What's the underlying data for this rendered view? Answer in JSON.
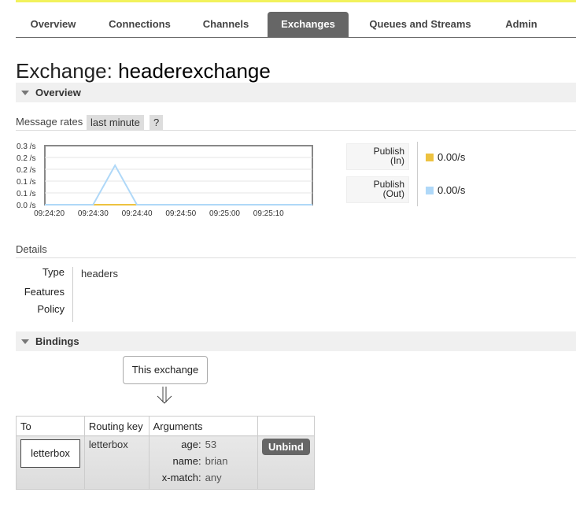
{
  "nav": {
    "items": [
      {
        "label": "Overview"
      },
      {
        "label": "Connections"
      },
      {
        "label": "Channels"
      },
      {
        "label": "Exchanges"
      },
      {
        "label": "Queues and Streams"
      },
      {
        "label": "Admin"
      }
    ],
    "active": "Exchanges"
  },
  "page": {
    "title_prefix": "Exchange:",
    "exchange_name": "headerexchange"
  },
  "overview": {
    "section_label": "Overview",
    "message_rates_label": "Message rates",
    "range_button": "last minute",
    "help_button": "?",
    "rates": [
      {
        "label_line1": "Publish",
        "label_line2": "(In)",
        "value": "0.00/s",
        "color": "#edc240"
      },
      {
        "label_line1": "Publish",
        "label_line2": "(Out)",
        "value": "0.00/s",
        "color": "#afd8f8"
      }
    ]
  },
  "chart_data": {
    "type": "line",
    "y_tick_labels": [
      "0.3 /s",
      "0.2 /s",
      "0.2 /s",
      "0.1 /s",
      "0.1 /s",
      "0.0 /s"
    ],
    "x_tick_labels": [
      "09:24:20",
      "09:24:30",
      "09:24:40",
      "09:24:50",
      "09:25:00",
      "09:25:10"
    ],
    "ylim": [
      0,
      0.3
    ],
    "grid": true,
    "series": [
      {
        "color": "#edc240",
        "points": [
          {
            "x": "09:24:19",
            "y": 0
          },
          {
            "x": "09:25:20",
            "y": 0
          }
        ]
      },
      {
        "color": "#afd8f8",
        "points": [
          {
            "x": "09:24:19",
            "y": 0
          },
          {
            "x": "09:24:30",
            "y": 0
          },
          {
            "x": "09:24:35",
            "y": 0.2
          },
          {
            "x": "09:24:40",
            "y": 0
          },
          {
            "x": "09:25:20",
            "y": 0
          }
        ]
      }
    ]
  },
  "details": {
    "heading": "Details",
    "rows": [
      {
        "label": "Type",
        "value": "headers"
      },
      {
        "label": "Features",
        "value": ""
      },
      {
        "label": "Policy",
        "value": ""
      }
    ]
  },
  "bindings": {
    "section_label": "Bindings",
    "this_exchange_label": "This exchange",
    "headers": {
      "to": "To",
      "routing_key": "Routing key",
      "arguments": "Arguments"
    },
    "rows": [
      {
        "to": "letterbox",
        "routing_key": "letterbox",
        "arguments": [
          {
            "key": "age:",
            "value": "53"
          },
          {
            "key": "name:",
            "value": "brian"
          },
          {
            "key": "x-match:",
            "value": "any"
          }
        ],
        "unbind_label": "Unbind"
      }
    ]
  }
}
